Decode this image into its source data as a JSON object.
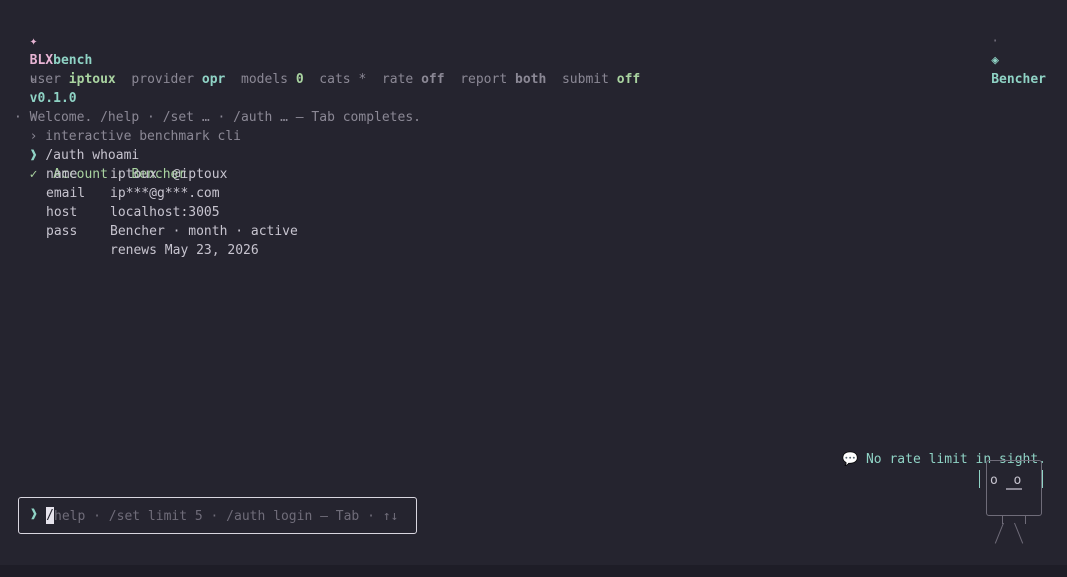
{
  "header": {
    "logo_glyph": "✦",
    "brand_blx": "BLX",
    "brand_bench": "bench",
    "play_glyph": "▸",
    "version": "v0.1.0",
    "sep": "·",
    "tagline": "› interactive benchmark cli",
    "right_sep": "·",
    "account_glyph": "◈",
    "account_name": "Bencher"
  },
  "status": [
    {
      "key": "user",
      "value": "iptoux"
    },
    {
      "key": "provider",
      "value": "opr"
    },
    {
      "key": "models",
      "value": "0"
    },
    {
      "key": "cats",
      "value": "*"
    },
    {
      "key": "rate",
      "value": "off"
    },
    {
      "key": "report",
      "value": "both"
    },
    {
      "key": "submit",
      "value": "off"
    }
  ],
  "log": {
    "welcome": "· Welcome. /help · /set … · /auth … — Tab completes.",
    "prompt_glyph": "❱",
    "command": "/auth whoami",
    "check_glyph": "✓",
    "result_title": "Account · Bencher",
    "rows": [
      {
        "label": "name",
        "value": "iptoux  @iptoux"
      },
      {
        "label": "email",
        "value": "ip***@g***.com"
      },
      {
        "label": "host",
        "value": "localhost:3005"
      },
      {
        "label": "pass",
        "value": "Bencher · month · active"
      },
      {
        "label": "",
        "value": "renews May 23, 2026"
      }
    ]
  },
  "bubble": {
    "glyph": "💬",
    "text": "No rate limit in sight."
  },
  "robot": {
    "eyes": "o  o"
  },
  "input": {
    "prompt_glyph": "❱",
    "caret_char": "/",
    "placeholder": "help · /set limit 5 · /auth login — Tab · ↑↓"
  }
}
